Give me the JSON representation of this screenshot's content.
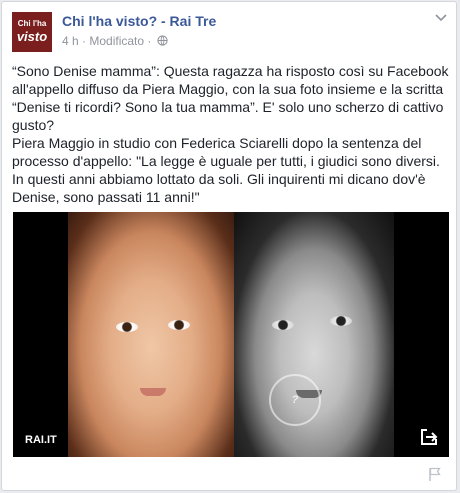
{
  "page": {
    "name": "Chi l'ha visto? - Rai Tre",
    "avatar_top": "Chi l'ha",
    "avatar_bottom": "visto"
  },
  "post": {
    "time": "4 h",
    "separator": " · ",
    "status": "Modificato",
    "audience_icon": "globe-icon",
    "menu_icon": "chevron-down-icon",
    "paragraph_1": "“Sono Denise mamma”: Questa ragazza ha risposto così su Facebook all'appello diffuso da Piera Maggio, con la sua foto insieme e la scritta “Denise ti ricordi? Sono la tua mamma”. E' solo uno scherzo di cattivo gusto?",
    "paragraph_2": "Piera Maggio in studio con Federica Sciarelli dopo la sentenza del processo d'appello: \"La legge è uguale per tutti, i giudici sono diversi. In questi anni abbiamo lottato da soli. Gli inquirenti mi dicano dov'è Denise, sono passati 11 anni!\""
  },
  "media": {
    "source": "RAI.IT",
    "share_icon": "share-icon",
    "left_photo": "child-photo",
    "right_photo": "girl-photo",
    "watermark_icon": "watermark-logo"
  },
  "footer": {
    "flag_icon": "flag-icon"
  },
  "colors": {
    "link": "#3b5998",
    "text": "#1d2129",
    "meta": "#90949c",
    "avatar_bg": "#7a1e1e"
  }
}
